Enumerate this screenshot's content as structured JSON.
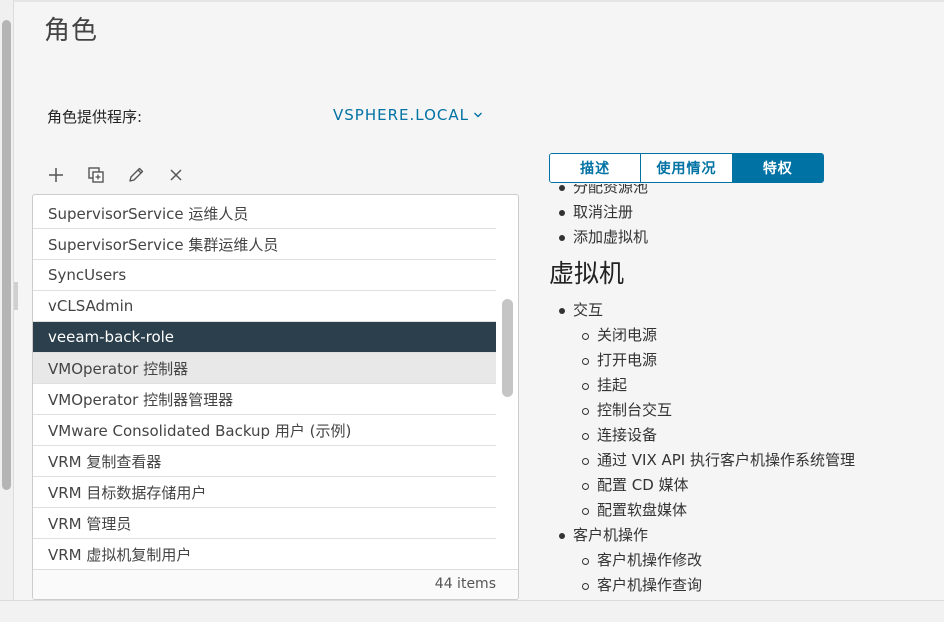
{
  "page": {
    "title": "角色"
  },
  "provider": {
    "label": "角色提供程序:",
    "value": "VSPHERE.LOCAL"
  },
  "toolbar": {
    "icons": [
      "add-icon",
      "clone-icon",
      "edit-icon",
      "delete-icon"
    ]
  },
  "roles": {
    "items": [
      {
        "label": "SupervisorService 运维人员"
      },
      {
        "label": "SupervisorService 集群运维人员"
      },
      {
        "label": "SyncUsers"
      },
      {
        "label": "vCLSAdmin"
      },
      {
        "label": "veeam-back-role"
      },
      {
        "label": "VMOperator 控制器"
      },
      {
        "label": "VMOperator 控制器管理器"
      },
      {
        "label": "VMware Consolidated Backup 用户 (示例)"
      },
      {
        "label": "VRM 复制查看器"
      },
      {
        "label": "VRM 目标数据存储用户"
      },
      {
        "label": "VRM 管理员"
      },
      {
        "label": "VRM 虚拟机复制用户"
      }
    ],
    "selected_index": 4,
    "hover_index": 5,
    "footer": "44 items"
  },
  "tabs": {
    "items": [
      {
        "label": "描述"
      },
      {
        "label": "使用情况"
      },
      {
        "label": "特权"
      }
    ],
    "active_index": 2
  },
  "privileges": {
    "lines": [
      {
        "text": "分配资源池",
        "level": 1
      },
      {
        "text": "取消注册",
        "level": 1
      },
      {
        "text": "添加虚拟机",
        "level": 1
      },
      {
        "text": "虚拟机",
        "level": 0
      },
      {
        "text": "交互",
        "level": 1
      },
      {
        "text": "关闭电源",
        "level": 2
      },
      {
        "text": "打开电源",
        "level": 2
      },
      {
        "text": "挂起",
        "level": 2
      },
      {
        "text": "控制台交互",
        "level": 2
      },
      {
        "text": "连接设备",
        "level": 2
      },
      {
        "text": "通过 VIX API 执行客户机操作系统管理",
        "level": 2
      },
      {
        "text": "配置 CD 媒体",
        "level": 2
      },
      {
        "text": "配置软盘媒体",
        "level": 2
      },
      {
        "text": "客户机操作",
        "level": 1
      },
      {
        "text": "客户机操作修改",
        "level": 2
      },
      {
        "text": "客户机操作查询",
        "level": 2
      }
    ]
  },
  "colors": {
    "accent": "#0072a3",
    "selected_row": "#2b3f4c"
  }
}
